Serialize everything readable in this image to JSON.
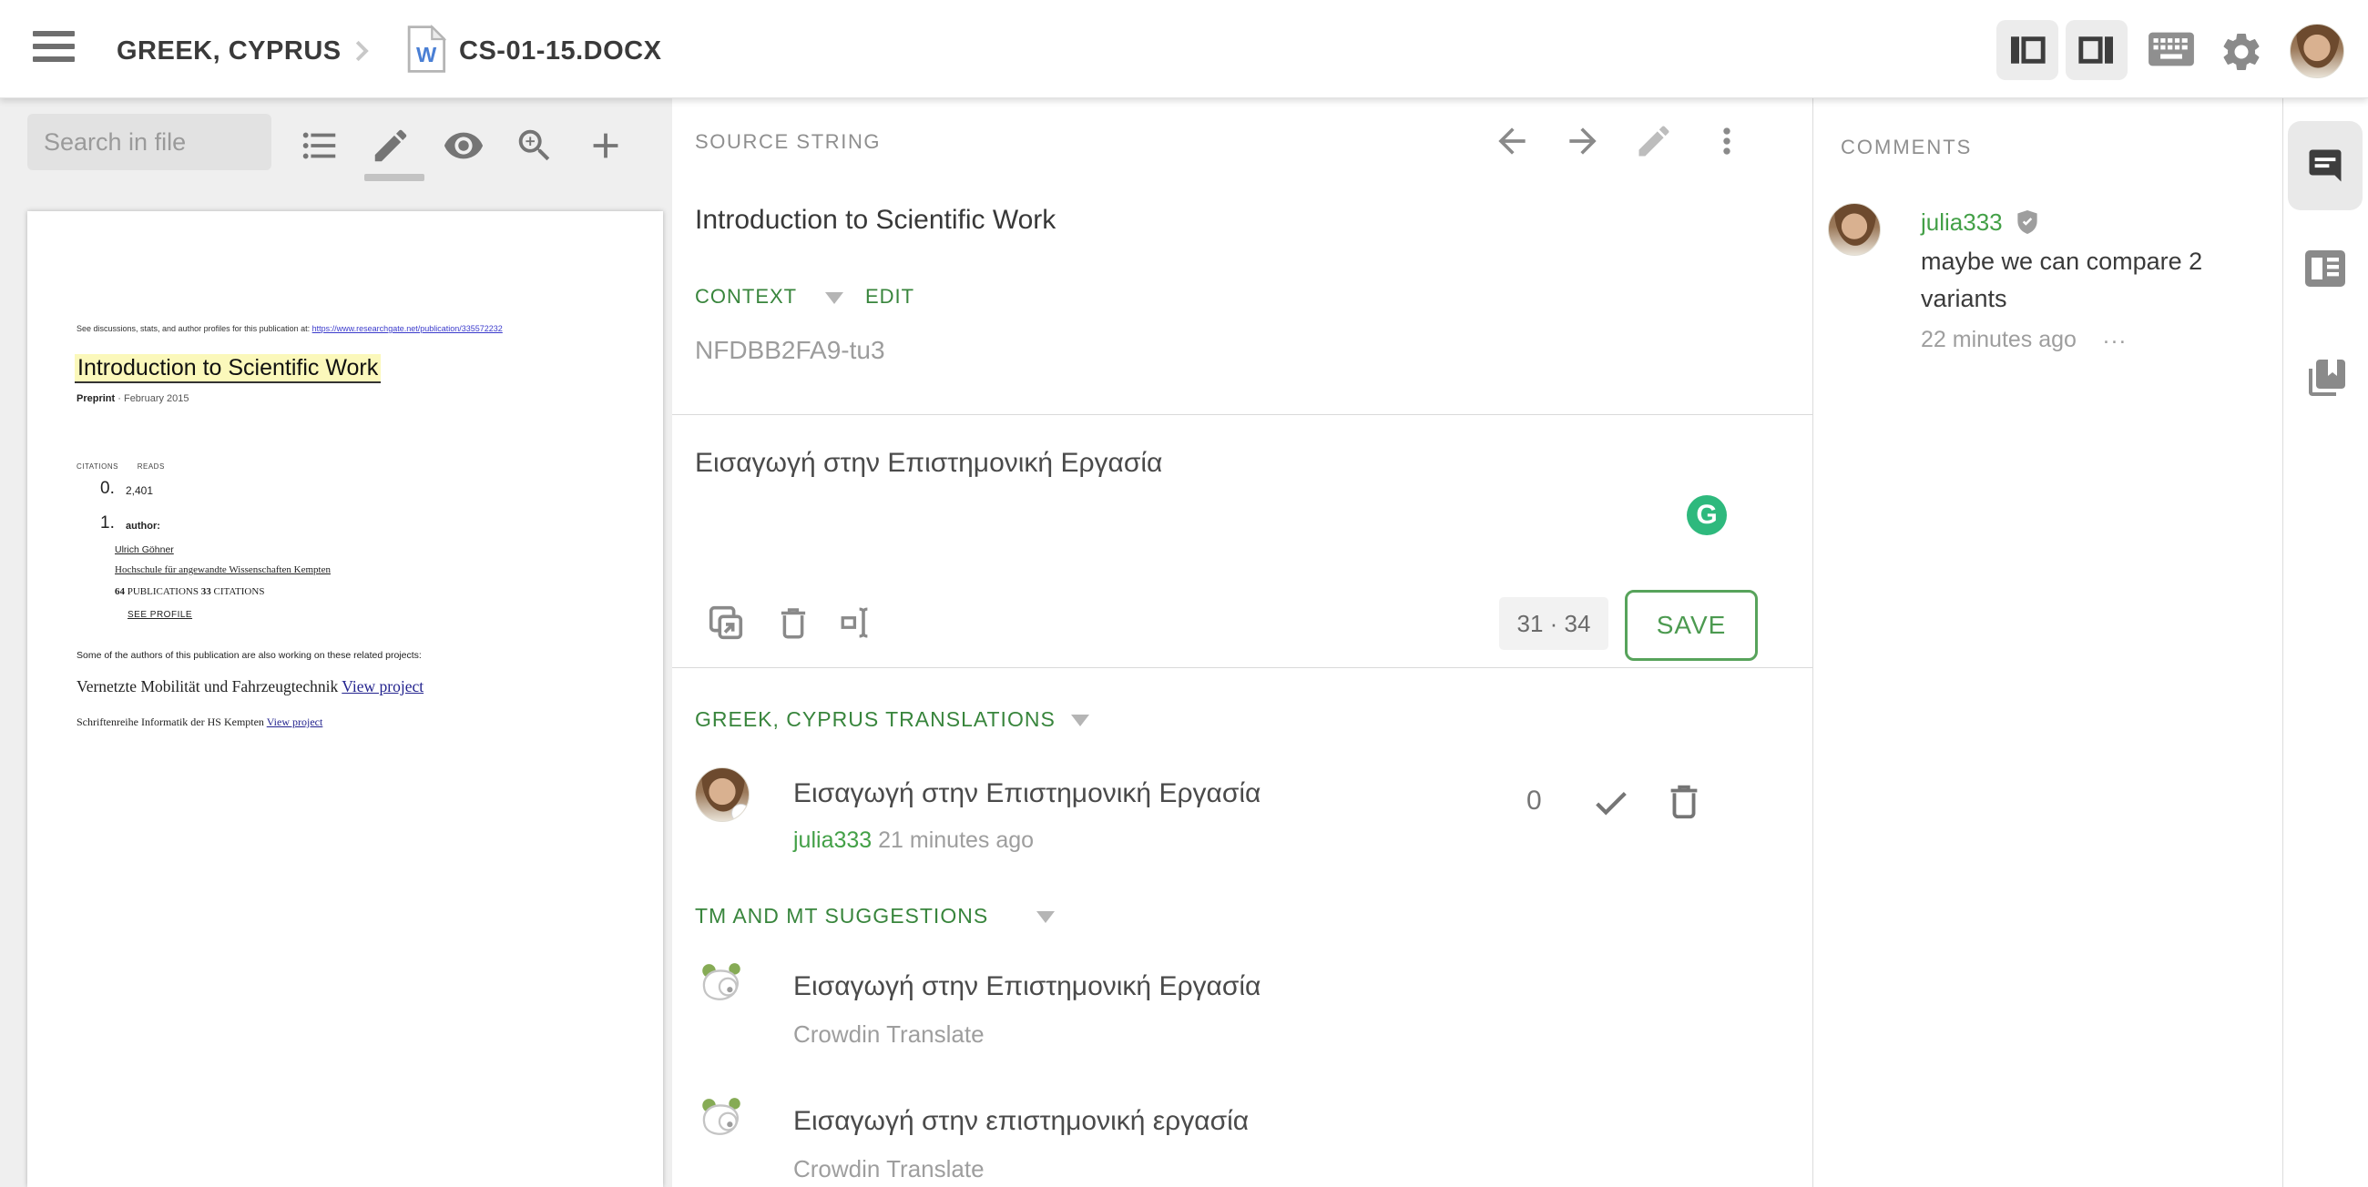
{
  "topbar": {
    "project": "GREEK, CYPRUS",
    "file": "CS-01-15.DOCX"
  },
  "left_panel": {
    "search_placeholder": "Search in file",
    "document": {
      "header_prefix": "See discussions, stats, and author profiles for this publication at:",
      "header_link": "https://www.researchgate.net/publication/335572232",
      "title": "Introduction to Scientific Work",
      "preprint_label": "Preprint",
      "preprint_rest": "· February 2015",
      "citations_label": "CITATIONS",
      "reads_label": "READS",
      "citations_value": "0.",
      "reads_value": "2,401",
      "author_index": "1.",
      "author_label": "author:",
      "author_name": "Ulrich Göhner",
      "author_affiliation": "Hochschule für angewandte Wissenschaften Kempten",
      "publications_count": "64",
      "publications_label": "PUBLICATIONS",
      "citations_count": "33",
      "citations_label2": "CITATIONS",
      "see_profile": "SEE PROFILE",
      "related_note": "Some of the authors of this publication are also working on these related projects:",
      "project1_title": "Vernetzte Mobilität und Fahrzeugtechnik",
      "project1_link": "View project",
      "project2_title": "Schriftenreihe Informatik der HS Kempten",
      "project2_link": "View project"
    }
  },
  "editor": {
    "source_header": "SOURCE STRING",
    "source_text": "Introduction to Scientific Work",
    "context_label": "CONTEXT",
    "edit_label": "EDIT",
    "context_value": "NFDBB2FA9-tu3",
    "translation_input": "Εισαγωγή στην Επιστημονική Εργασία",
    "counter": "31 · 34",
    "save_label": "SAVE",
    "translations_header": "GREEK, CYPRUS TRANSLATIONS",
    "translation": {
      "text": "Εισαγωγή στην Επιστημονική Εργασία",
      "author": "julia333",
      "time": "21 minutes ago",
      "rating": "0"
    },
    "suggestions_header": "TM AND MT SUGGESTIONS",
    "suggestions": [
      {
        "text": "Εισαγωγή στην Επιστημονική Εργασία",
        "provider": "Crowdin Translate"
      },
      {
        "text": "Εισαγωγή στην επιστημονική εργασία",
        "provider": "Crowdin Translate"
      }
    ]
  },
  "comments": {
    "header": "COMMENTS",
    "items": [
      {
        "author": "julia333",
        "text": "maybe we can compare 2 variants",
        "time": "22 minutes ago",
        "more": "..."
      }
    ]
  },
  "colors": {
    "accent_green": "#3e8e41",
    "save_green": "#4c9a50",
    "grammarly_green": "#2eb97d",
    "doc_link_blue": "#3b3bcc",
    "doc_link_navy": "#23238e"
  },
  "icons": {
    "word_doc_glyph": "W",
    "grammarly_glyph": "G",
    "menu-icon": "hamburger",
    "breadcrumb-chevron-icon": "chevron-right",
    "layout-left-icon": "panel-left-toggle",
    "layout-right-icon": "panel-right-toggle",
    "keyboard-icon": "keyboard",
    "settings-gear-icon": "gear",
    "strings-list-icon": "bulleted-list",
    "edit-pencil-icon": "pencil",
    "preview-eye-icon": "eye",
    "zoom-in-icon": "magnifier-plus",
    "add-plus-icon": "plus",
    "prev-string-icon": "arrow-left",
    "next-string-icon": "arrow-right",
    "more-kebab-icon": "kebab-dots",
    "copy-source-icon": "copy",
    "delete-trash-icon": "trash",
    "select-text-icon": "text-cursor",
    "approve-check-icon": "checkmark",
    "crowdin-panda-icon": "panda",
    "comments-tab-icon": "speech-bubble",
    "context-tab-icon": "reader",
    "glossary-tab-icon": "bookmarked-book",
    "verified-shield-icon": "shield-check"
  }
}
